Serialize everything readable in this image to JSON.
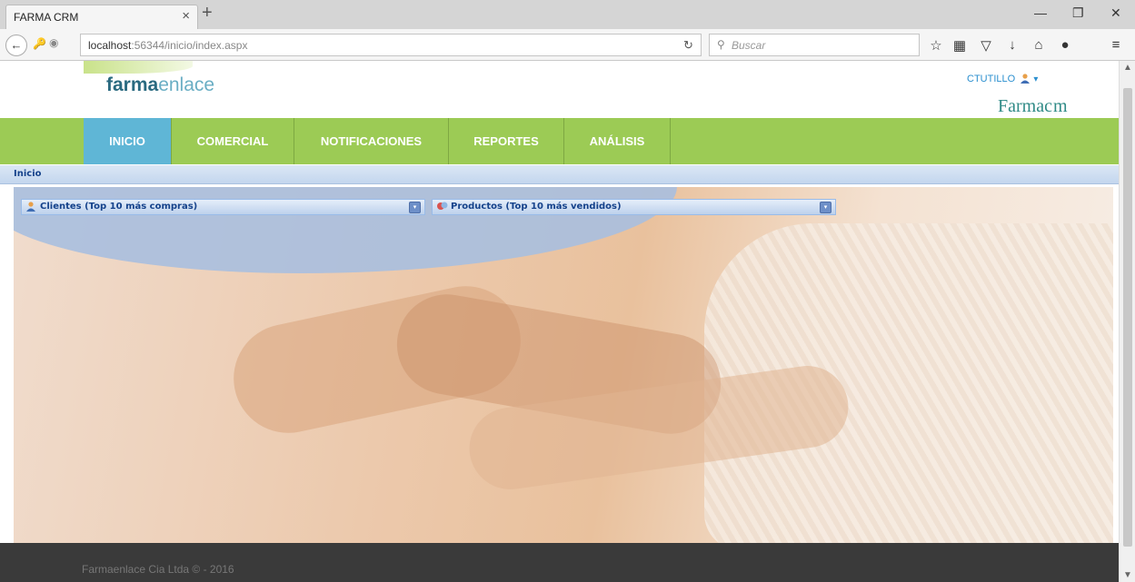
{
  "browser": {
    "tab_title": "FARMA CRM",
    "tab_close": "×",
    "new_tab": "+",
    "url_host": "localhost",
    "url_path": ":56344/inicio/index.aspx",
    "search_placeholder": "Buscar",
    "window_controls": [
      "—",
      "❐",
      "✕"
    ],
    "toolbar_icons": [
      "star-icon",
      "reading-list-icon",
      "pocket-icon",
      "download-icon",
      "home-icon",
      "chat-icon",
      "menu-icon"
    ]
  },
  "header": {
    "logo_bold": "farma",
    "logo_light": "enlace",
    "user_name": "CTUTILLO",
    "brand_farma": "Farma",
    "brand_cm": "cm"
  },
  "menu": {
    "items": [
      {
        "label": "INICIO",
        "active": true
      },
      {
        "label": "COMERCIAL",
        "active": false
      },
      {
        "label": "NOTIFICACIONES",
        "active": false
      },
      {
        "label": "REPORTES",
        "active": false
      },
      {
        "label": "ANÁLISIS",
        "active": false
      }
    ]
  },
  "breadcrumb": {
    "current": "Inicio"
  },
  "panels": [
    {
      "title": "Clientes (Top 10 más compras)",
      "icon": "user-icon"
    },
    {
      "title": "Productos (Top 10 más vendidos)",
      "icon": "product-icon"
    }
  ],
  "footer": {
    "text": "Farmaenlace Cia Ltda © - 2016"
  },
  "colors": {
    "menu_green": "#9ccb55",
    "menu_active": "#5fb6d6",
    "footer_bg": "#3a3a3a",
    "panel_title": "#15428b"
  }
}
